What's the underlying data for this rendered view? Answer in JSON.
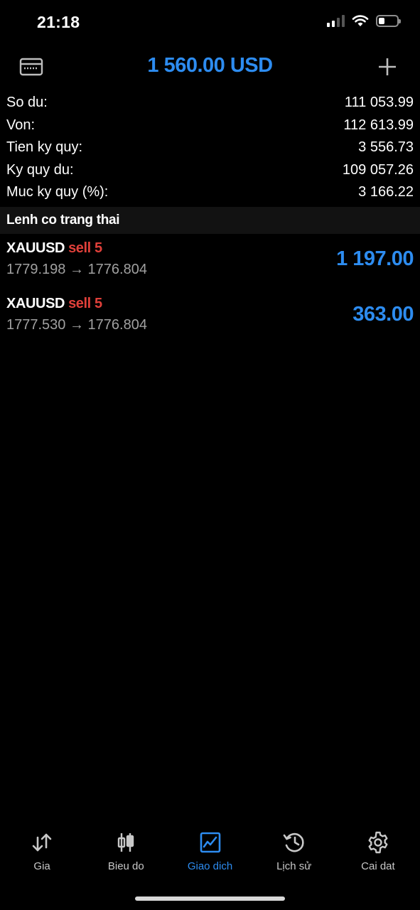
{
  "status_bar": {
    "time": "21:18",
    "battery_percent": 35
  },
  "header": {
    "balance_title": "1 560.00 USD",
    "left_icon": "wallet-card-icon",
    "right_icon": "plus-icon"
  },
  "summary": [
    {
      "label": "So du:",
      "value": "111 053.99"
    },
    {
      "label": "Von:",
      "value": "112 613.99"
    },
    {
      "label": "Tien ky quy:",
      "value": "3 556.73"
    },
    {
      "label": "Ky quy du:",
      "value": "109 057.26"
    },
    {
      "label": "Muc ky quy (%):",
      "value": "3 166.22"
    }
  ],
  "section_title": "Lenh co trang thai",
  "positions": [
    {
      "symbol": "XAUUSD",
      "side": "sell 5",
      "prices": "1779.198 → 1776.804",
      "profit": "1 197.00"
    },
    {
      "symbol": "XAUUSD",
      "side": "sell 5",
      "prices": "1777.530 → 1776.804",
      "profit": "363.00"
    }
  ],
  "tabs": [
    {
      "label": "Gia",
      "icon": "quotes-arrows-icon",
      "active": false
    },
    {
      "label": "Bieu do",
      "icon": "candlestick-chart-icon",
      "active": false
    },
    {
      "label": "Giao dich",
      "icon": "trade-chart-icon",
      "active": true
    },
    {
      "label": "Lịch sử",
      "icon": "history-clock-icon",
      "active": false
    },
    {
      "label": "Cai dat",
      "icon": "gear-icon",
      "active": false
    }
  ],
  "colors": {
    "accent": "#2d8cf0",
    "sell": "#e0403a",
    "background": "#000000"
  }
}
